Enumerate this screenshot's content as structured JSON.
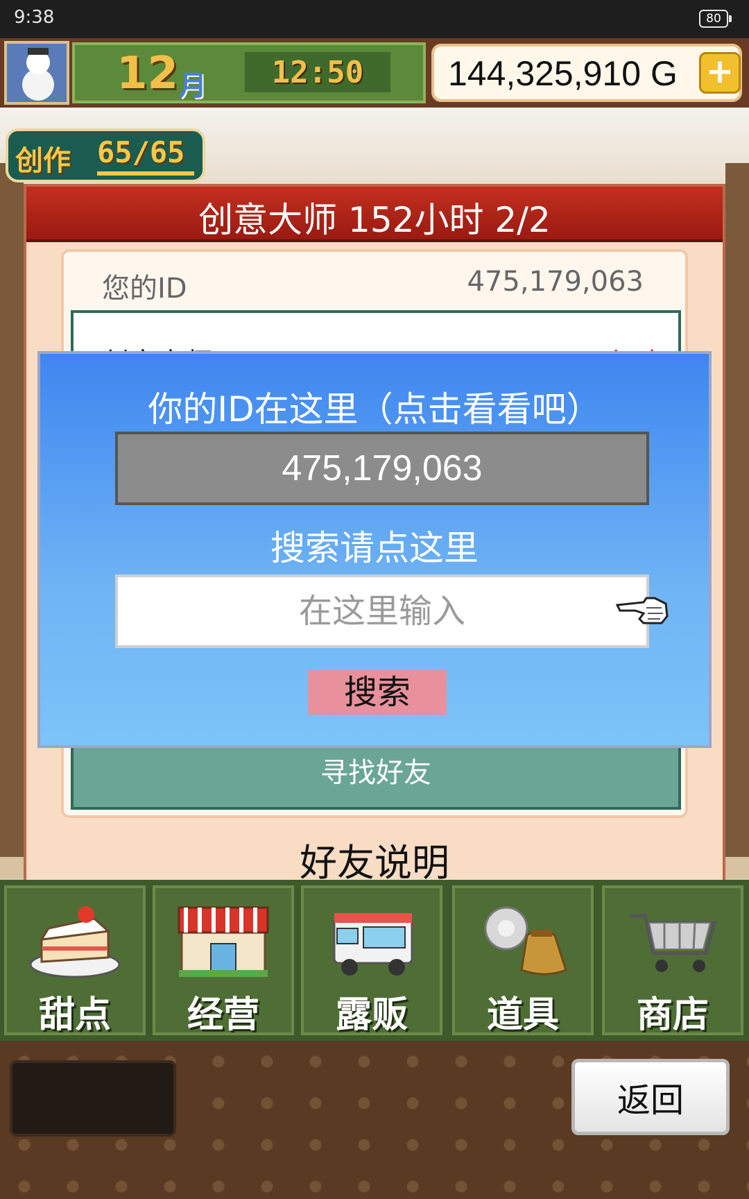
{
  "status_bar": {
    "time": "9:38",
    "battery": "80"
  },
  "hud": {
    "month_number": "12",
    "month_unit": "月",
    "clock": "12:50",
    "money": "144,325,910 G",
    "add_symbol": "+"
  },
  "creation": {
    "label": "创作",
    "count": "65/65"
  },
  "panel": {
    "title": "创意大师  152小时 2/2",
    "your_id_label": "您的ID",
    "your_id_value": "475,179,063",
    "row_peek_label": "创意大师",
    "row_peek_value": "15小时",
    "find_friend": "寻找好友",
    "friend_help": "好友说明"
  },
  "modal": {
    "title": "你的ID在这里（点击看看吧）",
    "id_value": "475,179,063",
    "search_hint": "搜索请点这里",
    "input_placeholder": "在这里输入",
    "search_button": "搜索"
  },
  "menu": [
    {
      "label": "甜点",
      "icon": "cake-icon"
    },
    {
      "label": "经营",
      "icon": "shop-icon"
    },
    {
      "label": "露贩",
      "icon": "food-truck-icon"
    },
    {
      "label": "道具",
      "icon": "items-bag-icon"
    },
    {
      "label": "商店",
      "icon": "cart-icon"
    }
  ],
  "footer": {
    "back_button": "返回"
  },
  "colors": {
    "panel_header": "#c2301f",
    "modal_top": "#3f86f0",
    "modal_bottom": "#7cc4f8",
    "search_button": "#e8909c",
    "menu_bg": "#4e6e36"
  }
}
